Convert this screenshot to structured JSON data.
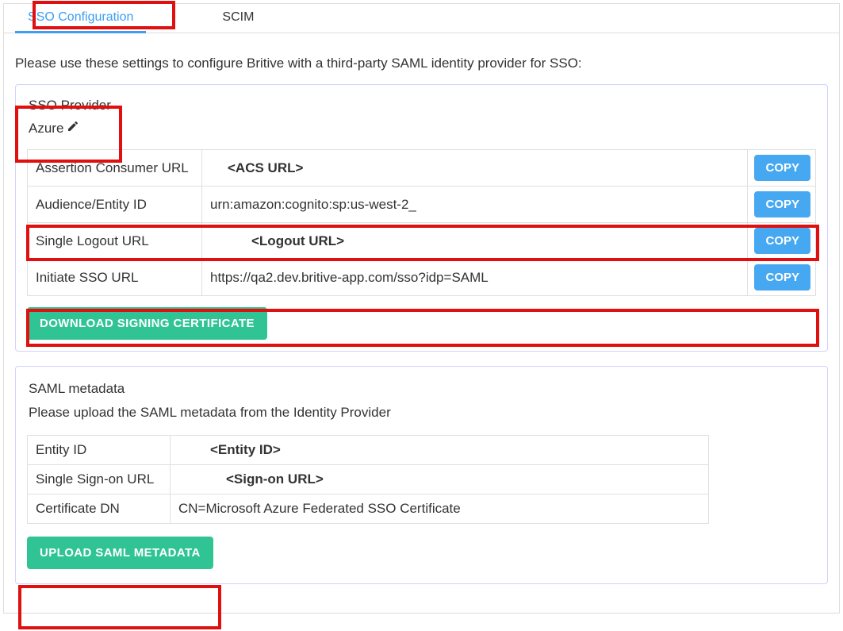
{
  "tabs": {
    "sso": "SSO Configuration",
    "scim": "SCIM"
  },
  "instructions": "Please use these settings to configure Britive with a third-party SAML identity provider for SSO:",
  "provider": {
    "label": "SSO Provider",
    "value": "Azure"
  },
  "url_rows": [
    {
      "label": "Assertion Consumer URL",
      "value": "<ACS URL>",
      "placeholder": true
    },
    {
      "label": "Audience/Entity ID",
      "value": "urn:amazon:cognito:sp:us-west-2_",
      "placeholder": false
    },
    {
      "label": "Single Logout URL",
      "value": "<Logout URL>",
      "placeholder": true
    },
    {
      "label": "Initiate SSO URL",
      "value": "https://qa2.dev.britive-app.com/sso?idp=SAML",
      "placeholder": false
    }
  ],
  "buttons": {
    "copy": "COPY",
    "download_cert": "DOWNLOAD SIGNING CERTIFICATE",
    "upload_metadata": "UPLOAD SAML METADATA"
  },
  "metadata": {
    "heading": "SAML metadata",
    "sub": "Please upload the SAML metadata from the Identity Provider",
    "rows": [
      {
        "label": "Entity ID",
        "value": "<Entity ID>",
        "placeholder": true
      },
      {
        "label": "Single Sign-on URL",
        "value": "<Sign-on URL>",
        "placeholder": true
      },
      {
        "label": "Certificate DN",
        "value": "CN=Microsoft Azure Federated SSO Certificate",
        "placeholder": false
      }
    ]
  }
}
